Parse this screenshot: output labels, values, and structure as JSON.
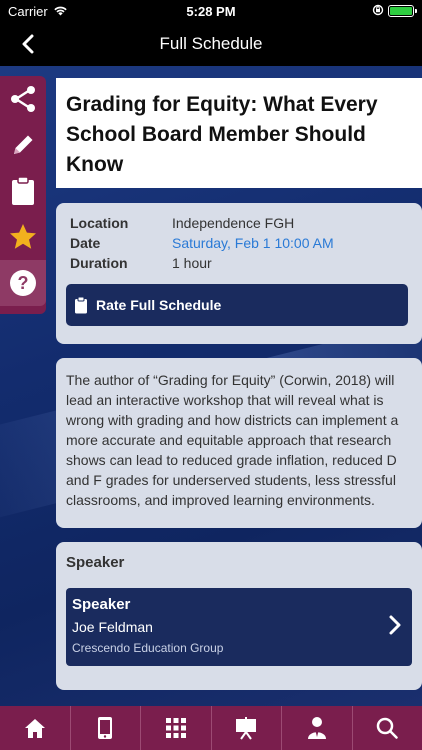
{
  "status": {
    "carrier": "Carrier",
    "time": "5:28 PM"
  },
  "nav": {
    "title": "Full Schedule"
  },
  "rail": {
    "icons": [
      "share-icon",
      "pencil-icon",
      "clipboard-icon",
      "star-icon",
      "help-icon"
    ]
  },
  "session": {
    "title": "Grading for Equity: What Every School Board Member Should Know",
    "location_label": "Location",
    "location": "Independence FGH",
    "date_label": "Date",
    "date": "Saturday, Feb 1 10:00 AM",
    "duration_label": "Duration",
    "duration": "1 hour",
    "rate_label": "Rate Full Schedule",
    "description": "The author of “Grading for Equity” (Corwin, 2018) will lead an interactive workshop that will reveal what is wrong with grading and how districts can implement a more accurate and equitable approach that research shows can lead to reduced grade inflation, reduced D and F grades for underserved students, less stressful classrooms, and improved learning environments."
  },
  "speakers": {
    "heading": "Speaker",
    "items": [
      {
        "label": "Speaker",
        "name": "Joe Feldman",
        "org": "Crescendo Education Group"
      }
    ]
  },
  "tabs": [
    "home-icon",
    "mobile-icon",
    "grid-icon",
    "presentation-icon",
    "attendee-icon",
    "search-icon"
  ],
  "colors": {
    "accent": "#7a1e4d",
    "navy": "#1a2b5e",
    "link": "#2a7ad6",
    "card": "#d8dde8"
  }
}
